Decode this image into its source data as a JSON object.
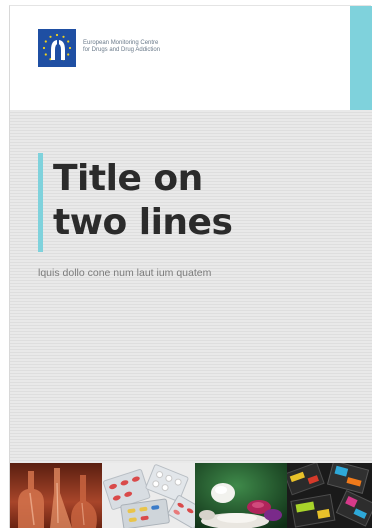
{
  "logo": {
    "name": "European Monitoring Centre for Drugs and Drug Addiction",
    "line1": "European Monitoring Centre",
    "line2": "for Drugs and Drug Addiction"
  },
  "cover": {
    "title_line1": "Title on",
    "title_line2": "two lines",
    "subtitle": "lquis dollo cone num laut ium quatem"
  },
  "photos": [
    {
      "name": "lab-glassware-photo"
    },
    {
      "name": "pill-blister-packs-photo"
    },
    {
      "name": "pills-and-powder-photo"
    },
    {
      "name": "drug-packets-photo"
    }
  ],
  "colors": {
    "accent": "#7fd2dc",
    "logo_blue": "#1f4fa3",
    "title": "#2b2b2b",
    "subtitle": "#7b7b7b",
    "background_gray": "#e6e6e6"
  }
}
